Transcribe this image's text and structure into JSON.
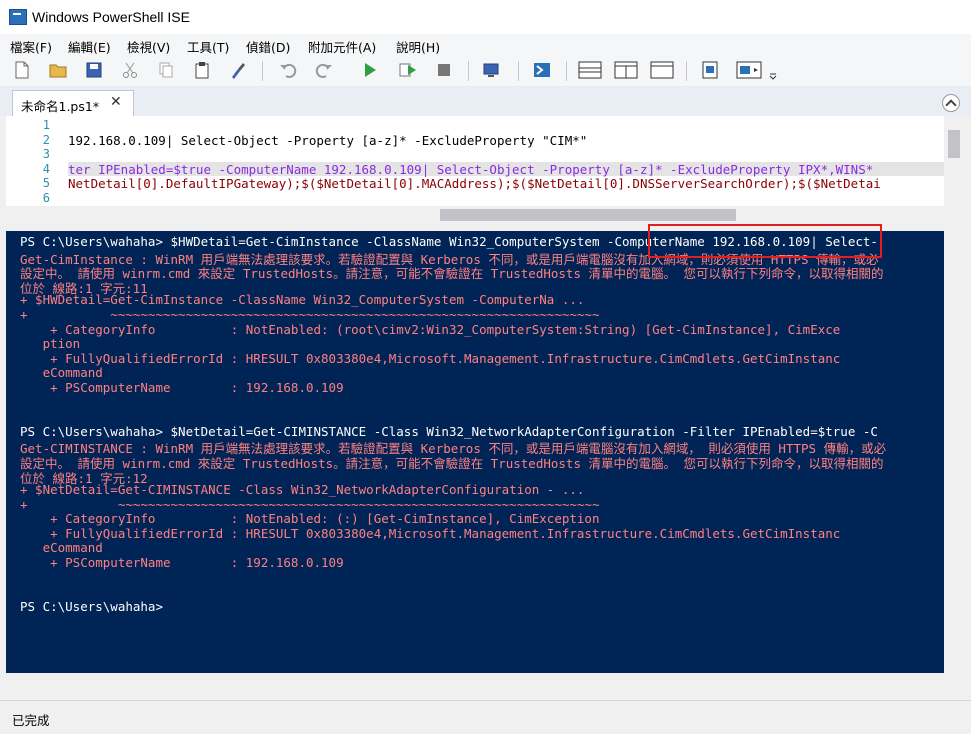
{
  "window": {
    "title": "Windows PowerShell ISE"
  },
  "menu": [
    "檔案(F)",
    "編輯(E)",
    "檢視(V)",
    "工具(T)",
    "偵錯(D)",
    "附加元件(A)",
    "說明(H)"
  ],
  "toolbar_icons": [
    "new-file-icon",
    "open-folder-icon",
    "save-icon",
    "cut-icon",
    "copy-icon",
    "paste-icon",
    "clear-icon",
    "undo-icon",
    "redo-icon",
    "run-icon",
    "run-selection-icon",
    "stop-icon",
    "remote-icon",
    "powershell-icon",
    "layout-top-icon",
    "layout-right-icon",
    "layout-max-icon",
    "script-pane-icon",
    "addon-pane-icon",
    "more-icon"
  ],
  "tab": {
    "label": "未命名1.ps1*",
    "close": "✕"
  },
  "editor": {
    "line_numbers": [
      "1",
      "2",
      "3",
      "4",
      "5",
      "6"
    ],
    "lines": [
      "",
      "192.168.0.109| Select-Object -Property [a-z]* -ExcludeProperty \"CIM*\"",
      "",
      "ter IPEnabled=$true -ComputerName 192.168.0.109| Select-Object -Property [a-z]* -ExcludeProperty IPX*,WINS*",
      "NetDetail[0].DefaultIPGateway);$($NetDetail[0].MACAddress);$($NetDetail[0].DNSServerSearchOrder);$($NetDetai",
      ""
    ]
  },
  "console": {
    "lines": [
      {
        "t": "PS C:\\Users\\wahaha> $HWDetail=Get-CimInstance -ClassName Win32_ComputerSystem -ComputerName 192.168.0.109| Select-",
        "c": "w"
      },
      {
        "t": "Get-CimInstance : WinRM 用戶端無法處理該要求。若驗證配置與 Kerberos 不同，或是用戶端電腦沒有加入網域，則必須使用 HTTPS 傳輸，或必",
        "c": "r"
      },
      {
        "t": "設定中。 請使用 winrm.cmd 來設定 TrustedHosts。請注意，可能不會驗證在 TrustedHosts 清單中的電腦。 您可以執行下列命令，以取得相關的",
        "c": "r"
      },
      {
        "t": "位於 線路:1 字元:11",
        "c": "r"
      },
      {
        "t": "+ $HWDetail=Get-CimInstance -ClassName Win32_ComputerSystem -ComputerNa ...",
        "c": "r"
      },
      {
        "t": "+           ~~~~~~~~~~~~~~~~~~~~~~~~~~~~~~~~~~~~~~~~~~~~~~~~~~~~~~~~~~~~~~~~~",
        "c": "r"
      },
      {
        "t": "    + CategoryInfo          : NotEnabled: (root\\cimv2:Win32_ComputerSystem:String) [Get-CimInstance], CimExce",
        "c": "r"
      },
      {
        "t": "   ption",
        "c": "r"
      },
      {
        "t": "    + FullyQualifiedErrorId : HRESULT 0x803380e4,Microsoft.Management.Infrastructure.CimCmdlets.GetCimInstanc",
        "c": "r"
      },
      {
        "t": "   eCommand",
        "c": "r"
      },
      {
        "t": "    + PSComputerName        : 192.168.0.109",
        "c": "r"
      },
      {
        "t": "",
        "c": "w"
      },
      {
        "t": "",
        "c": "w"
      },
      {
        "t": "PS C:\\Users\\wahaha> $NetDetail=Get-CIMINSTANCE -Class Win32_NetworkAdapterConfiguration -Filter IPEnabled=$true -C",
        "c": "w"
      },
      {
        "t": "Get-CIMINSTANCE : WinRM 用戶端無法處理該要求。若驗證配置與 Kerberos 不同，或是用戶端電腦沒有加入網域， 則必須使用 HTTPS 傳輸，或必",
        "c": "r"
      },
      {
        "t": "設定中。 請使用 winrm.cmd 來設定 TrustedHosts。請注意，可能不會驗證在 TrustedHosts 清單中的電腦。 您可以執行下列命令，以取得相關的",
        "c": "r"
      },
      {
        "t": "位於 線路:1 字元:12",
        "c": "r"
      },
      {
        "t": "+ $NetDetail=Get-CIMINSTANCE -Class Win32_NetworkAdapterConfiguration - ...",
        "c": "r"
      },
      {
        "t": "+            ~~~~~~~~~~~~~~~~~~~~~~~~~~~~~~~~~~~~~~~~~~~~~~~~~~~~~~~~~~~~~~~~",
        "c": "r"
      },
      {
        "t": "    + CategoryInfo          : NotEnabled: (:) [Get-CimInstance], CimException",
        "c": "r"
      },
      {
        "t": "    + FullyQualifiedErrorId : HRESULT 0x803380e4,Microsoft.Management.Infrastructure.CimCmdlets.GetCimInstanc",
        "c": "r"
      },
      {
        "t": "   eCommand",
        "c": "r"
      },
      {
        "t": "    + PSComputerName        : 192.168.0.109",
        "c": "r"
      },
      {
        "t": "",
        "c": "w"
      },
      {
        "t": "",
        "c": "w"
      },
      {
        "t": "PS C:\\Users\\wahaha>",
        "c": "w"
      }
    ]
  },
  "status": {
    "text": "已完成"
  },
  "colors": {
    "console_bg": "#012456",
    "console_text": "#ffffff",
    "error_text": "#ff8080",
    "highlight_box": "#e02020"
  }
}
